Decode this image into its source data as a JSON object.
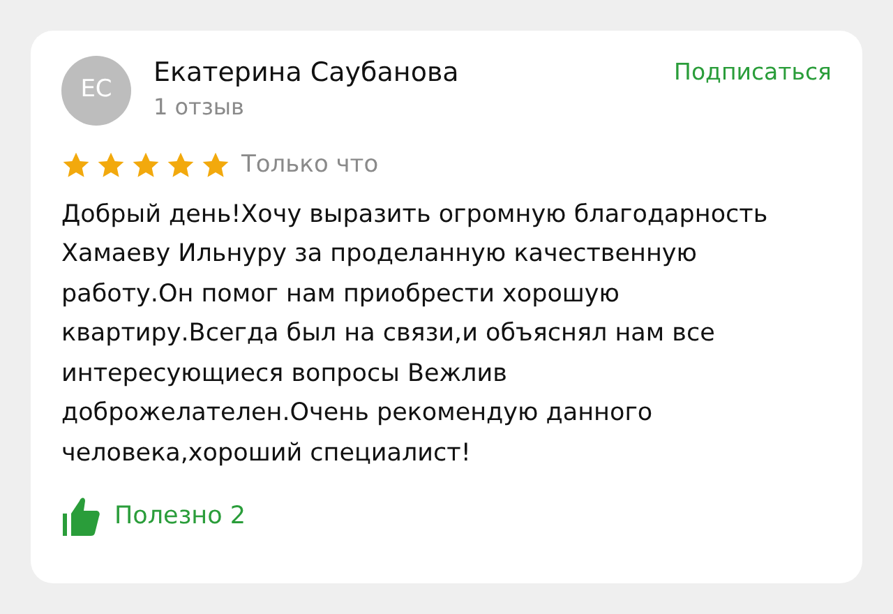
{
  "review": {
    "author": {
      "initials": "ЕС",
      "name": "Екатерина Саубанова",
      "reviews_count": "1 отзыв"
    },
    "subscribe": "Подписаться",
    "stars": 5,
    "time": "Только что",
    "text": "Добрый день!Хочу выразить огромную благодарность Хамаеву Ильнуру за проделанную качественную работу.Он помог нам приобрести хорошую квартиру.Всегда был на связи,и объяснял нам все интересующиеся вопросы Вежлив доброжелателен.Очень рекомендую данного человека,хороший специалист!",
    "helpful": {
      "label": "Полезно",
      "count": "2"
    }
  }
}
